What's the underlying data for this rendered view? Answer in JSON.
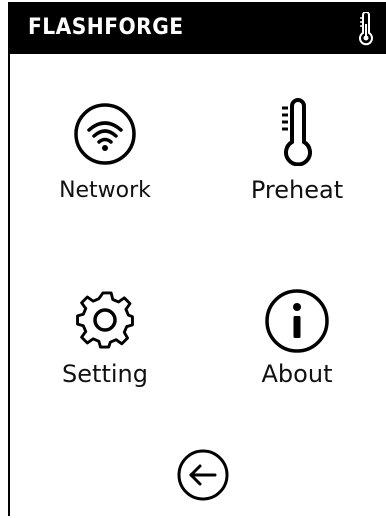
{
  "header": {
    "brand": "FLASHFORGE",
    "status_icon": "thermometer-icon"
  },
  "menu": {
    "items": [
      {
        "label": "Network",
        "icon": "wifi-icon"
      },
      {
        "label": "Preheat",
        "icon": "thermometer-icon"
      },
      {
        "label": "Setting",
        "icon": "gear-icon"
      },
      {
        "label": "About",
        "icon": "info-icon"
      }
    ]
  },
  "footer": {
    "back_icon": "back-arrow-icon"
  },
  "colors": {
    "header_bg": "#000000",
    "header_text": "#ffffff",
    "background": "#ffffff",
    "icon": "#000000",
    "text": "#111111"
  }
}
